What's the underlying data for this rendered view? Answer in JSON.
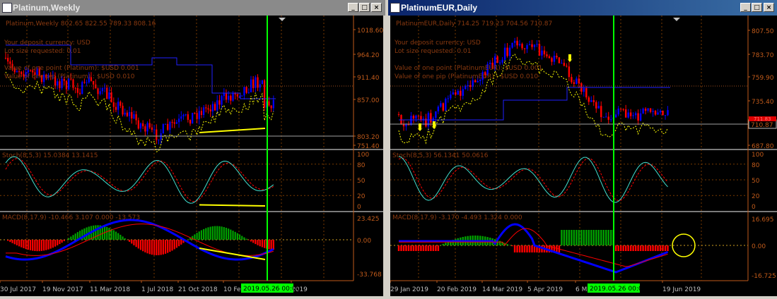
{
  "colors": {
    "bull": "#0000ff",
    "bear": "#ff0000",
    "grid": "#7a3a00",
    "axis": "#c05a1a",
    "text": "#8b3a10",
    "yellow": "#ffff00",
    "vline": "#00ff00",
    "stoch_main": "#40e0d0",
    "stoch_signal": "#ff0000",
    "macd_up": "#00a000",
    "macd_down": "#ff0000",
    "macd_line": "#0000ff",
    "macd_signal": "#ff0000"
  },
  "windows": [
    {
      "title": "Platinum,Weekly",
      "active": false,
      "ohlc_header": "Platinum,Weekly  802.65 822.55 789.33 808.16",
      "info_lines": [
        "Your deposit currency: USD",
        "Lot size requested: 0.01",
        "",
        "Value of one point (Platinum):  $USD 0.001",
        "Value of one pip    (Platinum) : $USD 0.010"
      ],
      "price_axis": [
        "1018.60",
        "964.20",
        "911.40",
        "857.00",
        "803.20",
        "751.40"
      ],
      "current_price": "808.16",
      "stoch_label": "Stoch(8,5,3) 15.0384 13.1415",
      "stoch_axis": [
        "100",
        "80",
        "50",
        "20",
        "0"
      ],
      "macd_label": "MACD(8,17,9) -10.466 3.107 0.000 -13.573",
      "macd_axis": [
        "23.425",
        "0.00",
        "-33.768"
      ],
      "time_axis": [
        "30 Jul 2017",
        "19 Nov 2017",
        "11 Mar 2018",
        "1 Jul 2018",
        "21 Oct 2018",
        "10 Feb",
        "2019"
      ],
      "cursor_time": "2019.05.26 00:00"
    },
    {
      "title": "PlatinumEUR,Daily",
      "active": true,
      "ohlc_header": "PlatinumEUR,Daily  714.25 719.23 704.56 710.87",
      "info_lines": [
        "Your deposit currency: USD",
        "Lot size requested: 0.01",
        "",
        "Value of one point (PlatinumEUR):  $USD 0.001",
        "Value of one pip    (PlatinumEUR) : $USD 0.010"
      ],
      "price_axis": [
        "807.50",
        "783.70",
        "759.90",
        "735.40",
        "710.87",
        "687.80"
      ],
      "current_price": "710.87",
      "price_marker_upper": "711.83",
      "stoch_label": "Stoch(8,5,3) 56.1341 50.0616",
      "stoch_axis": [
        "100",
        "80",
        "50",
        "20",
        "0"
      ],
      "macd_label": "MACD(8,17,9) -3.170 -4.493 1.324 0.000",
      "macd_axis": [
        "16.695",
        "0.00",
        "-16.725"
      ],
      "time_axis": [
        "29 Jan 2019",
        "20 Feb 2019",
        "14 Mar 2019",
        "5 Apr 2019",
        "6 Ma",
        "19 Jun 2019"
      ],
      "cursor_time": "2019.05.26 00:00"
    }
  ]
}
